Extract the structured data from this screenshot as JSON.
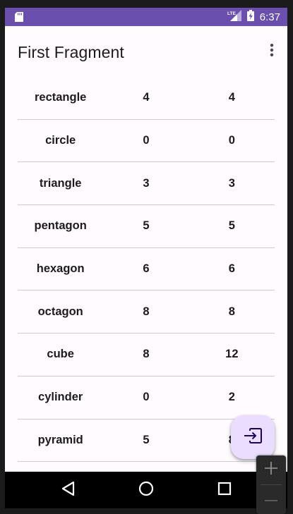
{
  "status_bar": {
    "time": "6:37",
    "network_label": "LTE",
    "icons": [
      "sd-card-icon",
      "lte-signal-icon",
      "battery-charging-icon"
    ],
    "color": "#6a4fae"
  },
  "app_bar": {
    "title": "First Fragment",
    "overflow_icon": "more-vert-icon"
  },
  "shapes_table": {
    "rows": [
      [
        "rectangle",
        "4",
        "4"
      ],
      [
        "circle",
        "0",
        "0"
      ],
      [
        "triangle",
        "3",
        "3"
      ],
      [
        "pentagon",
        "5",
        "5"
      ],
      [
        "hexagon",
        "6",
        "6"
      ],
      [
        "octagon",
        "8",
        "8"
      ],
      [
        "cube",
        "8",
        "12"
      ],
      [
        "cylinder",
        "0",
        "2"
      ],
      [
        "pyramid",
        "5",
        "8"
      ],
      [
        "",
        "",
        ""
      ]
    ]
  },
  "fab": {
    "icon": "input-icon",
    "color": "#eaddff"
  },
  "nav_bar": {
    "icons": [
      "back-icon",
      "home-icon",
      "recents-icon"
    ]
  },
  "zoom_control": {
    "icons": [
      "zoom-in-icon",
      "zoom-out-icon"
    ]
  }
}
